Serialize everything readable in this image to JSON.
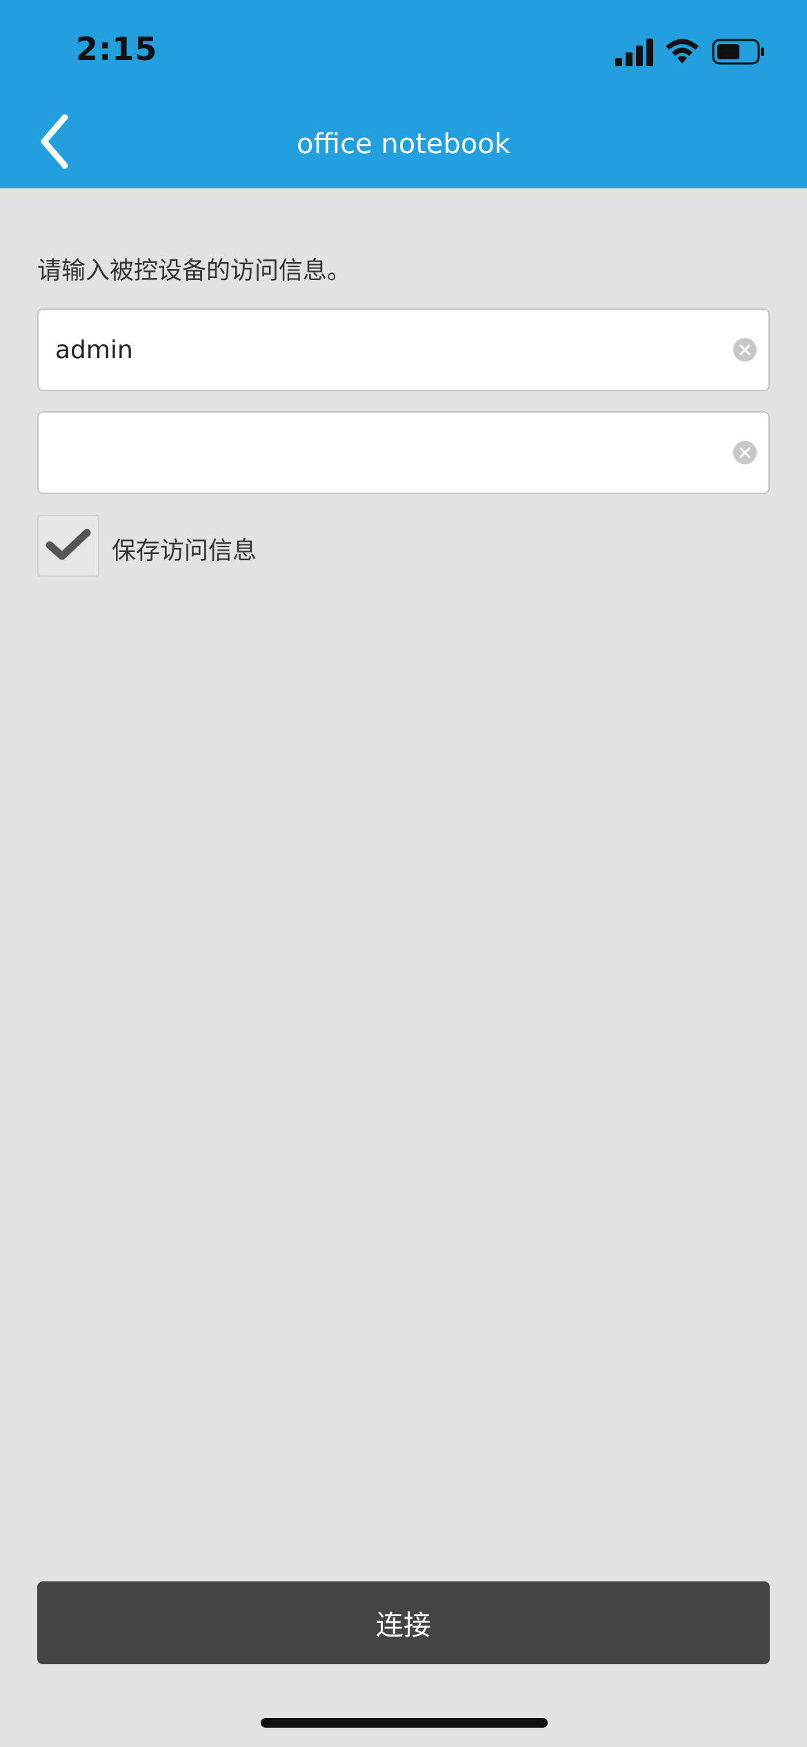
{
  "status_bar": {
    "time": "2:15"
  },
  "nav": {
    "title": "office notebook",
    "back_icon": "chevron-left-icon"
  },
  "form": {
    "instruction": "请输入被控设备的访问信息。",
    "username": {
      "value": "admin",
      "placeholder": ""
    },
    "password": {
      "value": "",
      "placeholder": ""
    },
    "save_checkbox": {
      "label": "保存访问信息",
      "checked": true
    }
  },
  "connect_button": {
    "label": "连接"
  },
  "colors": {
    "header": "#21a0dd",
    "background": "#e2e2e2",
    "button": "#444444"
  }
}
